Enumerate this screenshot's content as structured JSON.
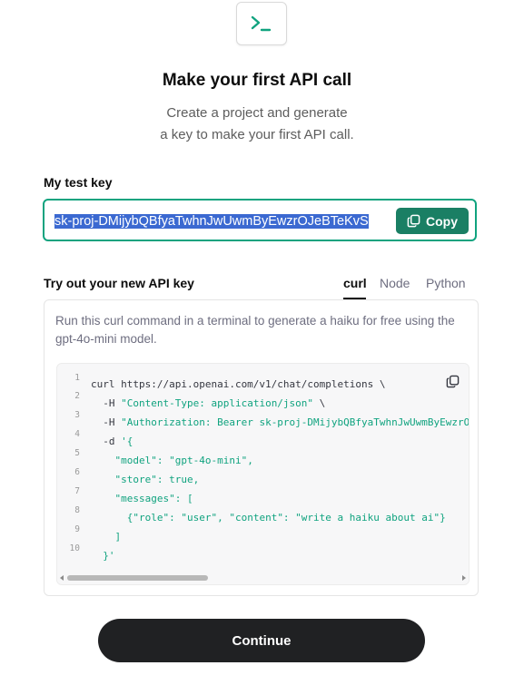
{
  "header": {
    "icon": "terminal-icon",
    "title": "Make your first API call",
    "subtitle_line1": "Create a project and generate",
    "subtitle_line2": "a key to make your first API call."
  },
  "key": {
    "label": "My test key",
    "value": "sk-proj-DMijybQBfyaTwhnJwUwmByEwzrOJeBTeKvS",
    "copy_label": "Copy",
    "accent_color": "#10a37f",
    "button_color": "#1a7f64"
  },
  "try": {
    "label": "Try out your new API key",
    "tabs": [
      {
        "label": "curl",
        "active": true
      },
      {
        "label": "Node",
        "active": false
      },
      {
        "label": "Python",
        "active": false
      }
    ],
    "description": "Run this curl command in a terminal to generate a haiku for free using the gpt-4o-mini model."
  },
  "code": {
    "line_numbers": [
      "1",
      "2",
      "3",
      "4",
      "5",
      "6",
      "7",
      "8",
      "9",
      "10"
    ],
    "lines": [
      {
        "plain": "curl https://api.openai.com/v1/chat/completions \\",
        "str": "",
        "tail": ""
      },
      {
        "plain": "  -H ",
        "str": "\"Content-Type: application/json\"",
        "tail": " \\"
      },
      {
        "plain": "  -H ",
        "str": "\"Authorization: Bearer sk-proj-DMijybQBfyaTwhnJwUwmByEwzrOJeBT",
        "tail": ""
      },
      {
        "plain": "  -d ",
        "str": "'{",
        "tail": ""
      },
      {
        "plain": "    ",
        "str": "\"model\": \"gpt-4o-mini\",",
        "tail": ""
      },
      {
        "plain": "    ",
        "str": "\"store\": true,",
        "tail": ""
      },
      {
        "plain": "    ",
        "str": "\"messages\": [",
        "tail": ""
      },
      {
        "plain": "      ",
        "str": "{\"role\": \"user\", \"content\": \"write a haiku about ai\"}",
        "tail": ""
      },
      {
        "plain": "    ",
        "str": "]",
        "tail": ""
      },
      {
        "plain": "  ",
        "str": "}'",
        "tail": ""
      }
    ]
  },
  "continue_label": "Continue"
}
